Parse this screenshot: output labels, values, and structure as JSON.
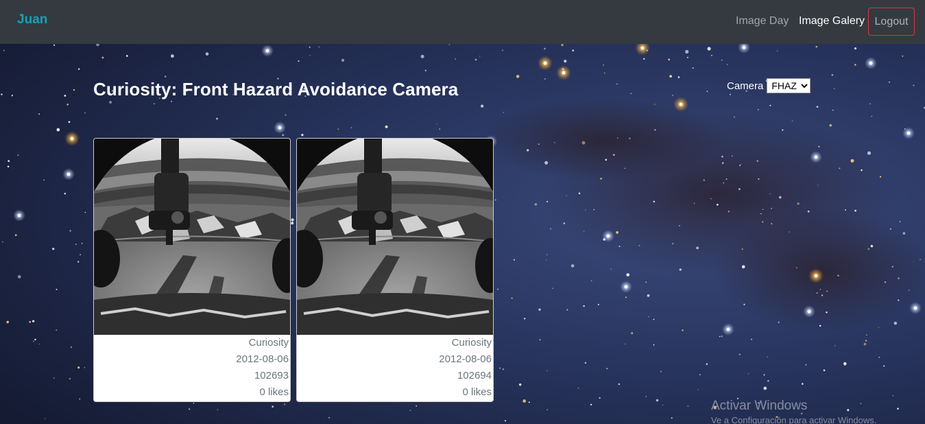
{
  "navbar": {
    "brand": "Juan",
    "links": [
      {
        "label": "Image Day",
        "active": false
      },
      {
        "label": "Image Galery",
        "active": true
      }
    ],
    "logout_label": "Logout"
  },
  "page": {
    "title": "Curiosity: Front Hazard Avoidance Camera",
    "camera": {
      "label": "Camera",
      "selected": "FHAZ"
    }
  },
  "cards": [
    {
      "rover": "Curiosity",
      "date": "2012-08-06",
      "id": "102693",
      "likes": "0 likes"
    },
    {
      "rover": "Curiosity",
      "date": "2012-08-06",
      "id": "102694",
      "likes": "0 likes"
    }
  ],
  "watermark": {
    "title": "Activar Windows",
    "subtitle": "Ve a Configuración para activar Windows."
  },
  "colors": {
    "navbar": "#343a40",
    "brand": "#17a2b8",
    "logout_border": "#dc3545",
    "card_text": "#6c757d"
  }
}
